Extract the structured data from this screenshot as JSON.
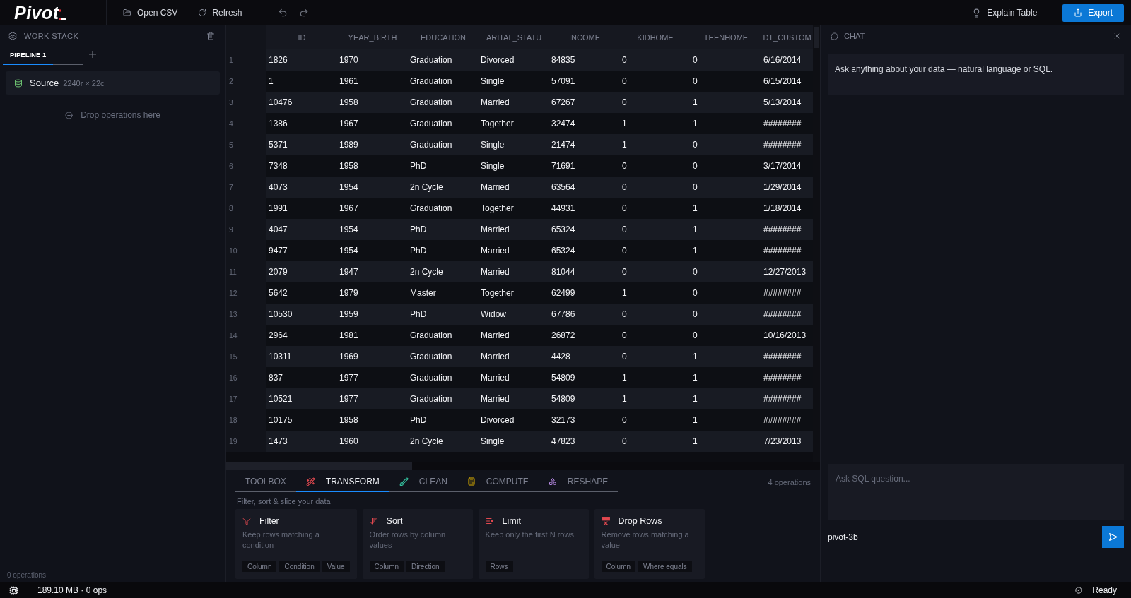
{
  "app": {
    "logo": "Pivot"
  },
  "toolbar": {
    "items": [
      {
        "label": "Open CSV",
        "kind": "open"
      },
      {
        "label": "Refresh",
        "kind": "refresh"
      }
    ],
    "history": [
      {
        "kind": "undo"
      },
      {
        "kind": "redo"
      }
    ],
    "actions": [
      {
        "label": "Explain Table",
        "kind": "hint"
      },
      {
        "label": "Export",
        "kind": "primary"
      }
    ]
  },
  "work_stack": {
    "title": "WORK STACK",
    "pipelines": [
      {
        "label": "PIPELINE 1",
        "selected": true
      }
    ],
    "source": {
      "name": "Source",
      "shape": "2240r × 22c"
    },
    "drop_hint": "Drop operations here",
    "footer": "0 operations"
  },
  "table": {
    "columns": [
      "ID",
      "YEAR_BIRTH",
      "EDUCATION",
      "ARITAL_STATU",
      "INCOME",
      "KIDHOME",
      "TEENHOME",
      "DT_CUSTOM"
    ],
    "rows": [
      {
        "index": "1",
        "cells": [
          "1826",
          "1970",
          "Graduation",
          "Divorced",
          "84835",
          "0",
          "0",
          "6/16/2014"
        ]
      },
      {
        "index": "2",
        "cells": [
          "1",
          "1961",
          "Graduation",
          "Single",
          "57091",
          "0",
          "0",
          "6/15/2014"
        ]
      },
      {
        "index": "3",
        "cells": [
          "10476",
          "1958",
          "Graduation",
          "Married",
          "67267",
          "0",
          "1",
          "5/13/2014"
        ]
      },
      {
        "index": "4",
        "cells": [
          "1386",
          "1967",
          "Graduation",
          "Together",
          "32474",
          "1",
          "1",
          "########"
        ]
      },
      {
        "index": "5",
        "cells": [
          "5371",
          "1989",
          "Graduation",
          "Single",
          "21474",
          "1",
          "0",
          "########"
        ]
      },
      {
        "index": "6",
        "cells": [
          "7348",
          "1958",
          "PhD",
          "Single",
          "71691",
          "0",
          "0",
          "3/17/2014"
        ]
      },
      {
        "index": "7",
        "cells": [
          "4073",
          "1954",
          "2n Cycle",
          "Married",
          "63564",
          "0",
          "0",
          "1/29/2014"
        ]
      },
      {
        "index": "8",
        "cells": [
          "1991",
          "1967",
          "Graduation",
          "Together",
          "44931",
          "0",
          "1",
          "1/18/2014"
        ]
      },
      {
        "index": "9",
        "cells": [
          "4047",
          "1954",
          "PhD",
          "Married",
          "65324",
          "0",
          "1",
          "########"
        ]
      },
      {
        "index": "10",
        "cells": [
          "9477",
          "1954",
          "PhD",
          "Married",
          "65324",
          "0",
          "1",
          "########"
        ]
      },
      {
        "index": "11",
        "cells": [
          "2079",
          "1947",
          "2n Cycle",
          "Married",
          "81044",
          "0",
          "0",
          "12/27/2013"
        ]
      },
      {
        "index": "12",
        "cells": [
          "5642",
          "1979",
          "Master",
          "Together",
          "62499",
          "1",
          "0",
          "########"
        ]
      },
      {
        "index": "13",
        "cells": [
          "10530",
          "1959",
          "PhD",
          "Widow",
          "67786",
          "0",
          "0",
          "########"
        ]
      },
      {
        "index": "14",
        "cells": [
          "2964",
          "1981",
          "Graduation",
          "Married",
          "26872",
          "0",
          "0",
          "10/16/2013"
        ]
      },
      {
        "index": "15",
        "cells": [
          "10311",
          "1969",
          "Graduation",
          "Married",
          "4428",
          "0",
          "1",
          "########"
        ]
      },
      {
        "index": "16",
        "cells": [
          "837",
          "1977",
          "Graduation",
          "Married",
          "54809",
          "1",
          "1",
          "########"
        ]
      },
      {
        "index": "17",
        "cells": [
          "10521",
          "1977",
          "Graduation",
          "Married",
          "54809",
          "1",
          "1",
          "########"
        ]
      },
      {
        "index": "18",
        "cells": [
          "10175",
          "1958",
          "PhD",
          "Divorced",
          "32173",
          "0",
          "1",
          "########"
        ]
      },
      {
        "index": "19",
        "cells": [
          "1473",
          "1960",
          "2n Cycle",
          "Single",
          "47823",
          "0",
          "1",
          "7/23/2013"
        ]
      }
    ]
  },
  "operations_panel": {
    "tabs": [
      {
        "label": "TOOLBOX",
        "kind": "plain",
        "selected": false
      },
      {
        "label": "TRANSFORM",
        "kind": "transform",
        "selected": true
      },
      {
        "label": "CLEAN",
        "kind": "clean",
        "selected": false
      },
      {
        "label": "COMPUTE",
        "kind": "compute",
        "selected": false
      },
      {
        "label": "RESHAPE",
        "kind": "reshape",
        "selected": false
      }
    ],
    "count": "4 operations",
    "description": "Filter, sort & slice your data",
    "cards": [
      {
        "kind": "filter",
        "title": "Filter",
        "description": "Keep rows matching a condition",
        "params": [
          "Column",
          "Condition",
          "Value"
        ]
      },
      {
        "kind": "sort",
        "title": "Sort",
        "description": "Order rows by column values",
        "params": [
          "Column",
          "Direction"
        ]
      },
      {
        "kind": "limit",
        "title": "Limit",
        "description": "Keep only the first N rows",
        "params": [
          "Rows"
        ]
      },
      {
        "kind": "drop",
        "title": "Drop Rows",
        "description": "Remove rows matching a value",
        "params": [
          "Column",
          "Where equals"
        ]
      }
    ]
  },
  "chat": {
    "title": "CHAT",
    "intro": "Ask anything about your data — natural language or SQL.",
    "input": {
      "placeholder": "Ask SQL question..."
    },
    "model": "pivot-3b"
  },
  "status_bar": {
    "memory": "189.10 MB · 0 ops",
    "status": "Ready"
  }
}
